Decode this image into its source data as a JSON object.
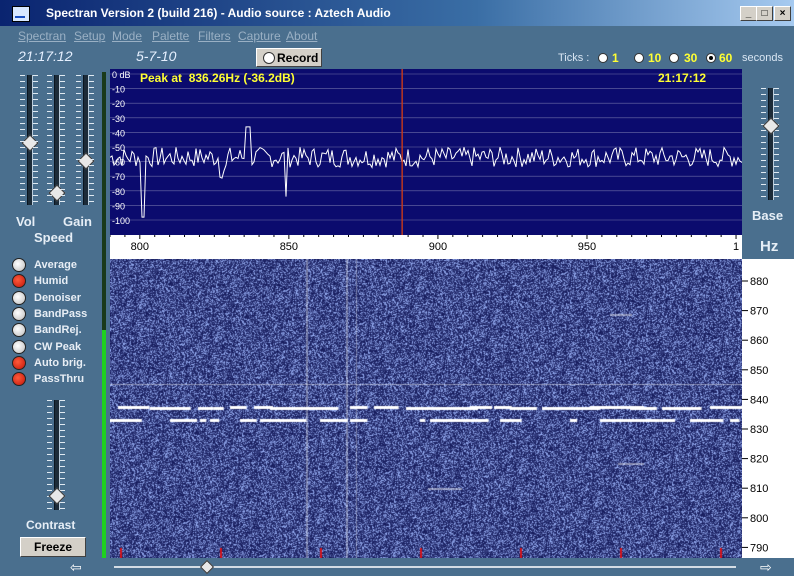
{
  "window": {
    "title": "Spectran Version 2 (build 216) - Audio source  :  Aztech Audio",
    "buttons": [
      "_",
      "□",
      "×"
    ]
  },
  "menu": [
    "Spectran",
    "Setup",
    "Mode",
    "Palette",
    "Filters",
    "Capture",
    "About"
  ],
  "toolbar": {
    "time": "21:17:12",
    "date": "5-7-10",
    "record_label": "Record",
    "ticks_label": "Ticks :",
    "tick_options": [
      "1",
      "10",
      "30",
      "60"
    ],
    "tick_selected": "60",
    "ticks_unit": "seconds"
  },
  "left_panel": {
    "vol_label": "Vol",
    "gain_label": "Gain",
    "speed_label": "Speed",
    "options": [
      {
        "label": "Average",
        "on": false
      },
      {
        "label": "Humid",
        "on": true
      },
      {
        "label": "Denoiser",
        "on": false
      },
      {
        "label": "BandPass",
        "on": false
      },
      {
        "label": "BandRej.",
        "on": false
      },
      {
        "label": "CW Peak",
        "on": false
      },
      {
        "label": "Auto brig.",
        "on": true
      },
      {
        "label": "PassThru",
        "on": true
      }
    ],
    "contrast_label": "Contrast",
    "freeze_label": "Freeze"
  },
  "right_panel": {
    "base_label": "Base",
    "hz_label": "Hz"
  },
  "spectrum": {
    "peak_text": "Peak at  836.26Hz (-36.2dB)",
    "time": "21:17:12",
    "db_ticks": [
      "0 dB",
      "-10",
      "-20",
      "-30",
      "-40",
      "-50",
      "-60",
      "-70",
      "-80",
      "-90",
      "-100"
    ],
    "x_ticks": [
      "800",
      "850",
      "900",
      "950",
      "1"
    ],
    "cursor_hz": 888,
    "colors": {
      "bg": "#0b0b6e",
      "grid": "#6e6ea8",
      "trace": "#ffffff",
      "peak_text": "#ffff33",
      "cursor": "#c83a1a"
    }
  },
  "waterfall": {
    "hz_ticks": [
      "880",
      "870",
      "860",
      "850",
      "840",
      "830",
      "820",
      "810",
      "800",
      "790"
    ]
  },
  "arrows": {
    "left": "⇦",
    "right": "⇨"
  }
}
